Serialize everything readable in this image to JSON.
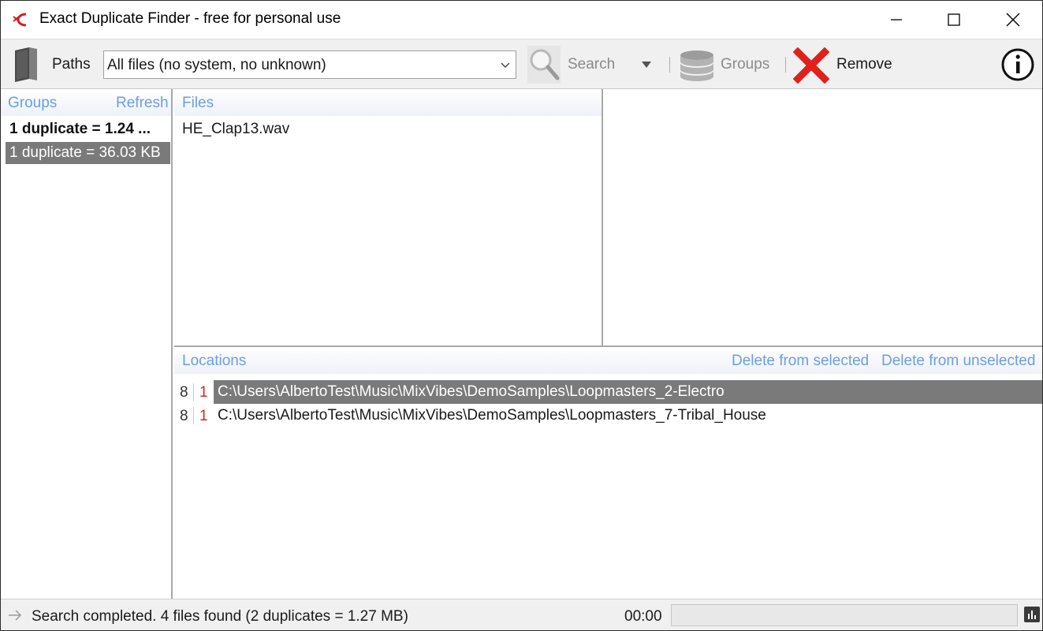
{
  "window": {
    "title": "Exact Duplicate Finder - free for personal use"
  },
  "toolbar": {
    "paths_label": "Paths",
    "filter_value": "All files (no system, no unknown)",
    "search_label": "Search",
    "groups_label": "Groups",
    "remove_label": "Remove"
  },
  "groups_panel": {
    "header": "Groups",
    "refresh": "Refresh",
    "items": [
      {
        "label": "1 duplicate = 1.24 ...",
        "bold": true,
        "selected": false
      },
      {
        "label": "1 duplicate = 36.03 KB",
        "bold": false,
        "selected": true
      }
    ]
  },
  "files_panel": {
    "header": "Files",
    "items": [
      "HE_Clap13.wav"
    ]
  },
  "locations_panel": {
    "header": "Locations",
    "delete_selected": "Delete from selected",
    "delete_unselected": "Delete from unselected",
    "rows": [
      {
        "count": "8",
        "index": "1",
        "path": "C:\\Users\\AlbertoTest\\Music\\MixVibes\\DemoSamples\\Loopmasters_2-Electro",
        "selected": true
      },
      {
        "count": "8",
        "index": "1",
        "path": "C:\\Users\\AlbertoTest\\Music\\MixVibes\\DemoSamples\\Loopmasters_7-Tribal_House",
        "selected": false
      }
    ]
  },
  "statusbar": {
    "message": "Search completed. 4 files found (2 duplicates = 1.27 MB)",
    "elapsed": "00:00",
    "progress_percent": 0
  },
  "colors": {
    "link": "#6a9ee8",
    "selection": "#7a7a7a",
    "remove_x": "#e0201c",
    "index_red": "#dd2222"
  },
  "icons": {
    "app": "app-logo-icon",
    "paths": "book-icon",
    "search": "magnifier-icon",
    "groups": "database-icon",
    "remove": "red-x-icon",
    "info": "info-icon",
    "status": "arrow-right-icon",
    "stats": "bar-chart-icon"
  }
}
